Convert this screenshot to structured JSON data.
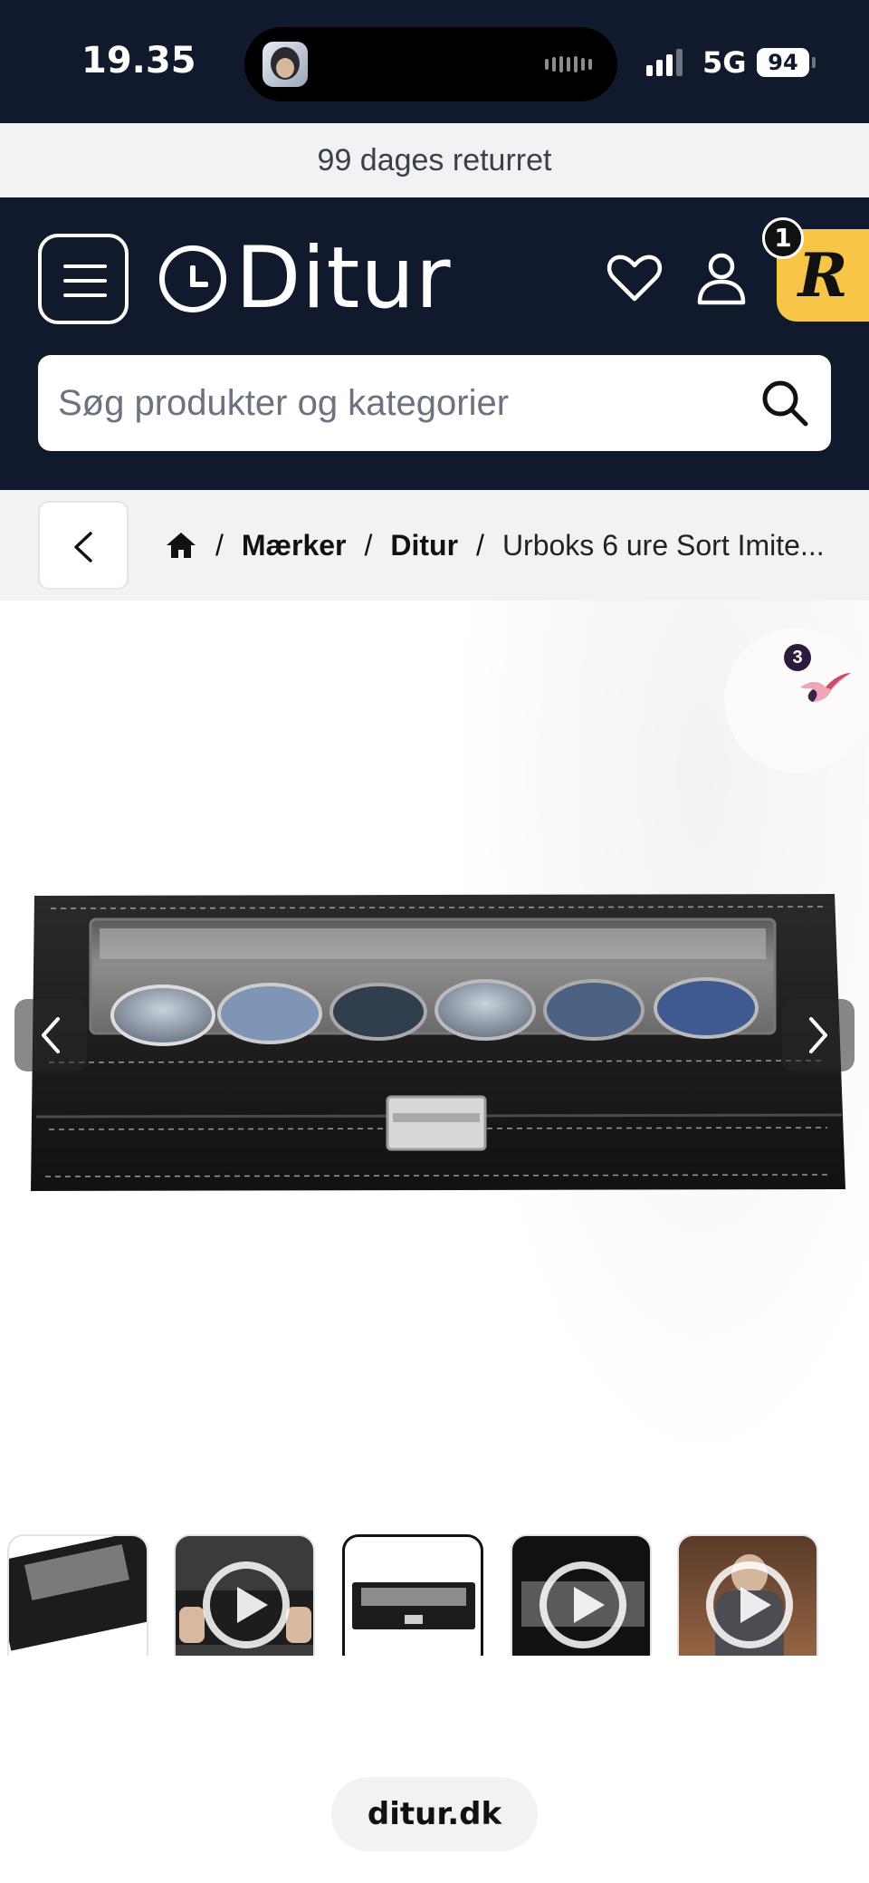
{
  "status_bar": {
    "time": "19.35",
    "network": "5G",
    "battery": "94"
  },
  "promo": {
    "text": "99 dages returret"
  },
  "header": {
    "logo_text": "Ditur",
    "search_placeholder": "Søg produkter og kategorier",
    "notification_count": "1",
    "review_widget_letter": "R",
    "icons": [
      "menu-icon",
      "heart-icon",
      "user-icon",
      "bag-icon",
      "search-icon"
    ]
  },
  "breadcrumb": {
    "items": [
      "Mærker",
      "Ditur"
    ],
    "current": "Urboks 6 ure Sort Imite..."
  },
  "product": {
    "wishlist_count": "3",
    "gallery_active_index": 2,
    "thumbnail_count": 5
  },
  "footer": {
    "url": "ditur.dk"
  },
  "colors": {
    "header_bg": "#111a2c",
    "banner_bg": "#f1f2f4",
    "review_widget": "#f7c548",
    "wishlist_badge": "#2d1b3d"
  }
}
